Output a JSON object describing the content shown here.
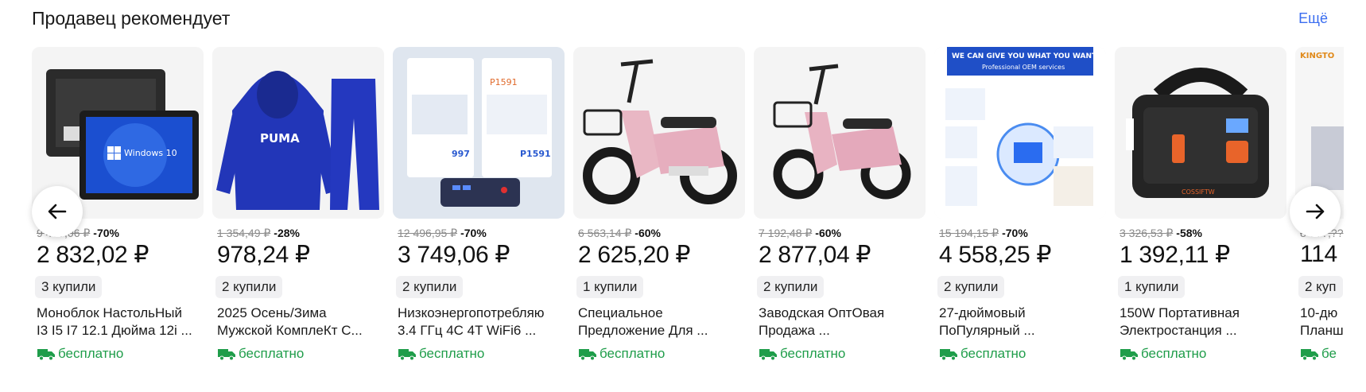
{
  "header": {
    "title": "Продавец рекомендует",
    "more_label": "Ещё"
  },
  "colors": {
    "accent": "#3a6df0",
    "free_shipping": "#1f9d4a"
  },
  "icons": {
    "prev": "arrow-left-icon",
    "next": "arrow-right-icon",
    "shipping": "truck-icon"
  },
  "products": [
    {
      "old_price": "9 4??,06 ₽",
      "discount": "-70%",
      "price": "2 832,02 ₽",
      "bought": "3 купили",
      "name_line1": "Моноблок НастольНый",
      "name_line2": "I3 I5 I7 12.1 Дюйма 12i ...",
      "shipping": "бесплатно",
      "image_text": "Windows 10"
    },
    {
      "old_price": "1 354,49 ₽",
      "discount": "-28%",
      "price": "978,24 ₽",
      "bought": "2 купили",
      "name_line1": "2025 Осень/Зима",
      "name_line2": "Мужской КомплеКт С...",
      "shipping": "бесплатно",
      "image_text": "PUMA"
    },
    {
      "old_price": "12 496,95 ₽",
      "discount": "-70%",
      "price": "3 749,06 ₽",
      "bought": "2 купили",
      "name_line1": "Низкоэнергопотребляю",
      "name_line2": "3.4 ГГц 4C 4T WiFi6 ...",
      "shipping": "бесплатно",
      "image_text": "P1591"
    },
    {
      "old_price": "6 563,14 ₽",
      "discount": "-60%",
      "price": "2 625,20 ₽",
      "bought": "1 купили",
      "name_line1": "Специальное",
      "name_line2": "Предложение Для ...",
      "shipping": "бесплатно",
      "image_text": ""
    },
    {
      "old_price": "7 192,48 ₽",
      "discount": "-60%",
      "price": "2 877,04 ₽",
      "bought": "2 купили",
      "name_line1": "Заводская ОптОвая",
      "name_line2": "Продажа ...",
      "shipping": "бесплатно",
      "image_text": ""
    },
    {
      "old_price": "15 194,15 ₽",
      "discount": "-70%",
      "price": "4 558,25 ₽",
      "bought": "2 купили",
      "name_line1": "27-дюймовый",
      "name_line2": "ПоПулярный ...",
      "shipping": "бесплатно",
      "image_text": "WE CAN GIVE YOU WHAT YOU WANT"
    },
    {
      "old_price": "3 326,53 ₽",
      "discount": "-58%",
      "price": "1 392,11 ₽",
      "bought": "1 купили",
      "name_line1": "150W Портативная",
      "name_line2": "Электростанция ...",
      "shipping": "бесплатно",
      "image_text": ""
    },
    {
      "old_price": "8 3??,??",
      "discount": "",
      "price": "114",
      "bought": "2 куп",
      "name_line1": "10-дю",
      "name_line2": "Планш",
      "shipping": "бе",
      "image_text": "KINGTO"
    }
  ]
}
